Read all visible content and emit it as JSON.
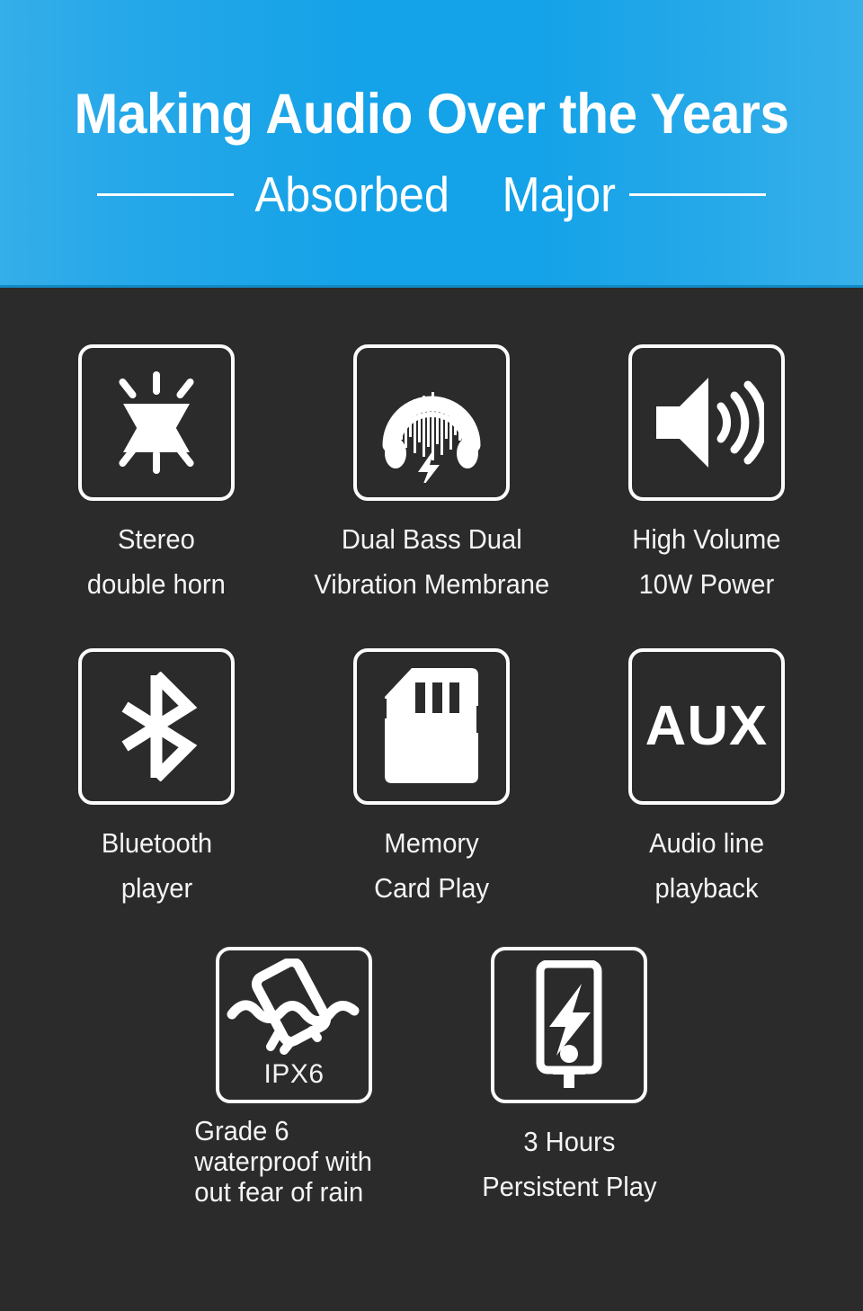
{
  "banner": {
    "title": "Making Audio Over the Years",
    "subtitle_left_word": "Absorbed",
    "subtitle_right_word": "Major",
    "bg_color_light": "#35aee9",
    "bg_color_deep": "#14a2e8",
    "text_color": "#ffffff"
  },
  "page": {
    "background_color": "#2b2b2b",
    "icon_color": "#ffffff"
  },
  "features": {
    "rows": [
      {
        "cells": [
          {
            "icon": "stereo-double-horn-icon",
            "caption_lines": [
              "Stereo",
              "double horn"
            ]
          },
          {
            "icon": "headphones-waveform-bass-icon",
            "caption_lines": [
              "Dual Bass Dual",
              "Vibration Membrane"
            ]
          },
          {
            "icon": "speaker-volume-icon",
            "caption_lines": [
              "High Volume",
              "10W Power"
            ]
          }
        ]
      },
      {
        "cells": [
          {
            "icon": "bluetooth-icon",
            "caption_lines": [
              "Bluetooth",
              "player"
            ]
          },
          {
            "icon": "memory-card-icon",
            "caption_lines": [
              "Memory",
              "Card Play"
            ]
          },
          {
            "icon": "aux-icon",
            "icon_text": "AUX",
            "caption_lines": [
              "Audio line",
              "playback"
            ]
          }
        ]
      },
      {
        "cells": [
          {
            "icon": "waterproof-ipx6-icon",
            "icon_text": "IPX6",
            "caption_lines": [
              "Grade 6",
              "waterproof with",
              "out fear of rain"
            ]
          },
          {
            "icon": "battery-charge-device-icon",
            "caption_lines": [
              "3 Hours",
              "Persistent Play"
            ]
          }
        ]
      }
    ]
  }
}
